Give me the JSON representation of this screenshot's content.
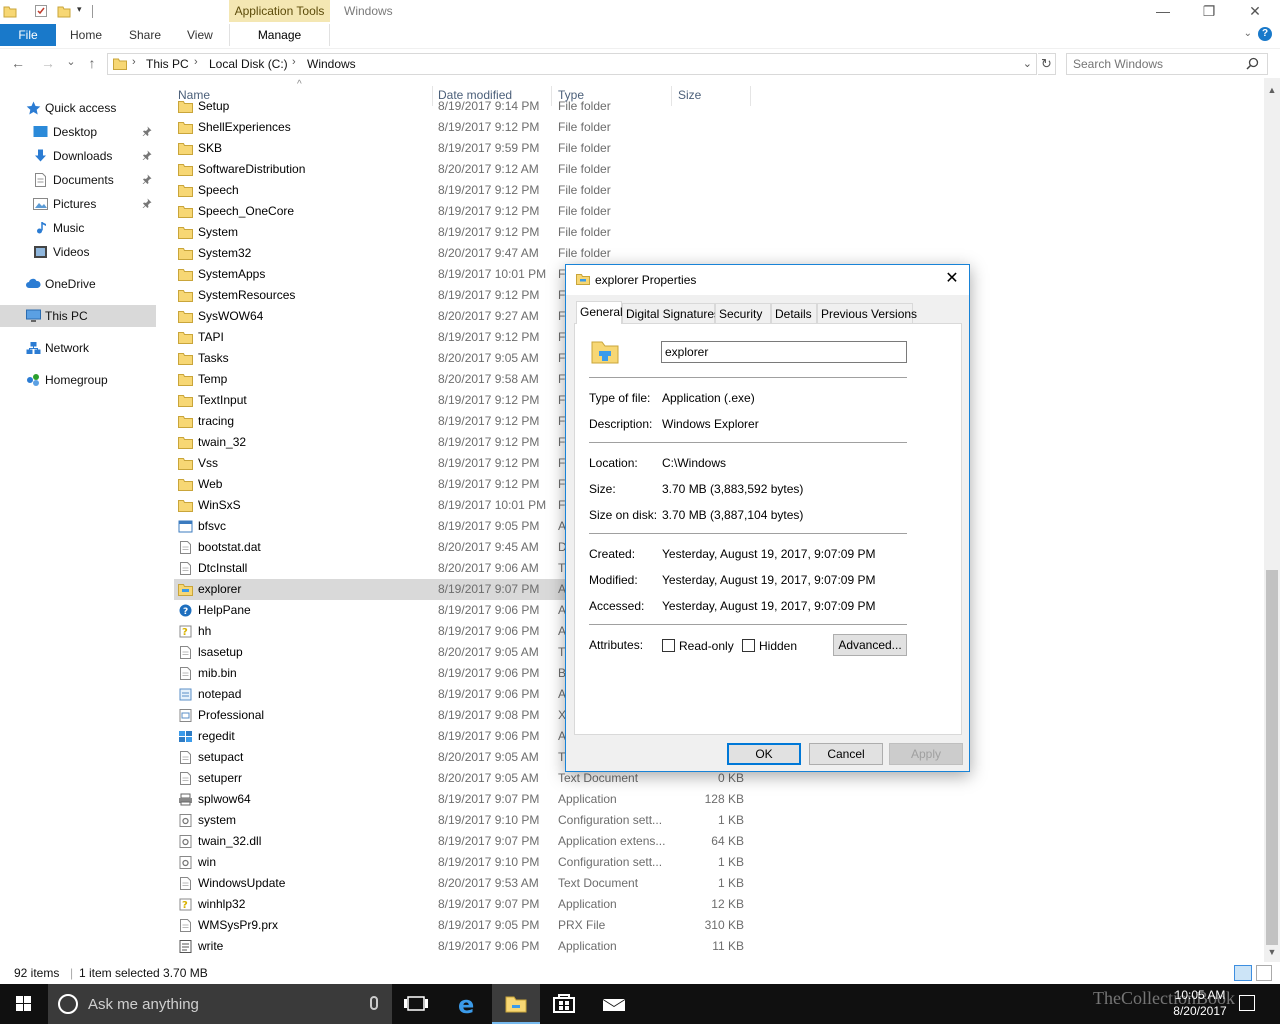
{
  "titlebar": {
    "context_tab_group": "Application Tools",
    "window_title": "Windows",
    "minimize": "—",
    "maximize": "❐",
    "close": "✕"
  },
  "ribbon": {
    "tabs": [
      {
        "label": "File"
      },
      {
        "label": "Home"
      },
      {
        "label": "Share"
      },
      {
        "label": "View"
      },
      {
        "label": "Manage"
      }
    ],
    "expand_icon": "chevron-down-icon",
    "help_icon": "?"
  },
  "address": {
    "back": "←",
    "forward": "→",
    "recent": "⌄",
    "up": "↑",
    "crumbs": [
      "This PC",
      "Local Disk (C:)",
      "Windows"
    ],
    "separator": "›",
    "dropdown": "⌄",
    "refresh": "↻",
    "search_placeholder": "Search Windows"
  },
  "navpane": {
    "items": [
      {
        "label": "Quick access",
        "icon": "star-icon",
        "pinned": false
      },
      {
        "label": "Desktop",
        "icon": "desktop-icon",
        "pinned": true
      },
      {
        "label": "Downloads",
        "icon": "download-icon",
        "pinned": true
      },
      {
        "label": "Documents",
        "icon": "documents-icon",
        "pinned": true
      },
      {
        "label": "Pictures",
        "icon": "pictures-icon",
        "pinned": true
      },
      {
        "label": "Music",
        "icon": "music-icon",
        "pinned": false
      },
      {
        "label": "Videos",
        "icon": "videos-icon",
        "pinned": false
      },
      {
        "label": "OneDrive",
        "icon": "cloud-icon",
        "pinned": false
      },
      {
        "label": "This PC",
        "icon": "computer-icon",
        "pinned": false,
        "selected": true
      },
      {
        "label": "Network",
        "icon": "network-icon",
        "pinned": false
      },
      {
        "label": "Homegroup",
        "icon": "homegroup-icon",
        "pinned": false
      }
    ]
  },
  "columns": {
    "name": "Name",
    "date": "Date modified",
    "type": "Type",
    "size": "Size",
    "sort_indicator": "^"
  },
  "files": [
    {
      "name": "Setup",
      "date": "8/19/2017 9:14 PM",
      "type": "File folder",
      "size": "",
      "icon": "folder"
    },
    {
      "name": "ShellExperiences",
      "date": "8/19/2017 9:12 PM",
      "type": "File folder",
      "size": "",
      "icon": "folder"
    },
    {
      "name": "SKB",
      "date": "8/19/2017 9:59 PM",
      "type": "File folder",
      "size": "",
      "icon": "folder"
    },
    {
      "name": "SoftwareDistribution",
      "date": "8/20/2017 9:12 AM",
      "type": "File folder",
      "size": "",
      "icon": "folder"
    },
    {
      "name": "Speech",
      "date": "8/19/2017 9:12 PM",
      "type": "File folder",
      "size": "",
      "icon": "folder"
    },
    {
      "name": "Speech_OneCore",
      "date": "8/19/2017 9:12 PM",
      "type": "File folder",
      "size": "",
      "icon": "folder"
    },
    {
      "name": "System",
      "date": "8/19/2017 9:12 PM",
      "type": "File folder",
      "size": "",
      "icon": "folder"
    },
    {
      "name": "System32",
      "date": "8/20/2017 9:47 AM",
      "type": "File folder",
      "size": "",
      "icon": "folder"
    },
    {
      "name": "SystemApps",
      "date": "8/19/2017 10:01 PM",
      "type": "F",
      "size": "",
      "icon": "folder"
    },
    {
      "name": "SystemResources",
      "date": "8/19/2017 9:12 PM",
      "type": "F",
      "size": "",
      "icon": "folder"
    },
    {
      "name": "SysWOW64",
      "date": "8/20/2017 9:27 AM",
      "type": "F",
      "size": "",
      "icon": "folder"
    },
    {
      "name": "TAPI",
      "date": "8/19/2017 9:12 PM",
      "type": "F",
      "size": "",
      "icon": "folder"
    },
    {
      "name": "Tasks",
      "date": "8/20/2017 9:05 AM",
      "type": "F",
      "size": "",
      "icon": "folder"
    },
    {
      "name": "Temp",
      "date": "8/20/2017 9:58 AM",
      "type": "F",
      "size": "",
      "icon": "folder"
    },
    {
      "name": "TextInput",
      "date": "8/19/2017 9:12 PM",
      "type": "F",
      "size": "",
      "icon": "folder"
    },
    {
      "name": "tracing",
      "date": "8/19/2017 9:12 PM",
      "type": "F",
      "size": "",
      "icon": "folder"
    },
    {
      "name": "twain_32",
      "date": "8/19/2017 9:12 PM",
      "type": "F",
      "size": "",
      "icon": "folder"
    },
    {
      "name": "Vss",
      "date": "8/19/2017 9:12 PM",
      "type": "F",
      "size": "",
      "icon": "folder"
    },
    {
      "name": "Web",
      "date": "8/19/2017 9:12 PM",
      "type": "F",
      "size": "",
      "icon": "folder"
    },
    {
      "name": "WinSxS",
      "date": "8/19/2017 10:01 PM",
      "type": "F",
      "size": "",
      "icon": "folder"
    },
    {
      "name": "bfsvc",
      "date": "8/19/2017 9:05 PM",
      "type": "A",
      "size": "",
      "icon": "app"
    },
    {
      "name": "bootstat.dat",
      "date": "8/20/2017 9:45 AM",
      "type": "D",
      "size": "",
      "icon": "doc"
    },
    {
      "name": "DtcInstall",
      "date": "8/20/2017 9:06 AM",
      "type": "T",
      "size": "",
      "icon": "doc"
    },
    {
      "name": "explorer",
      "date": "8/19/2017 9:07 PM",
      "type": "A",
      "size": "",
      "icon": "explorer",
      "selected": true
    },
    {
      "name": "HelpPane",
      "date": "8/19/2017 9:06 PM",
      "type": "A",
      "size": "",
      "icon": "help"
    },
    {
      "name": "hh",
      "date": "8/19/2017 9:06 PM",
      "type": "A",
      "size": "",
      "icon": "hh"
    },
    {
      "name": "lsasetup",
      "date": "8/20/2017 9:05 AM",
      "type": "T",
      "size": "",
      "icon": "doc"
    },
    {
      "name": "mib.bin",
      "date": "8/19/2017 9:06 PM",
      "type": "B",
      "size": "",
      "icon": "doc"
    },
    {
      "name": "notepad",
      "date": "8/19/2017 9:06 PM",
      "type": "A",
      "size": "",
      "icon": "notepad"
    },
    {
      "name": "Professional",
      "date": "8/19/2017 9:08 PM",
      "type": "X",
      "size": "",
      "icon": "xml"
    },
    {
      "name": "regedit",
      "date": "8/19/2017 9:06 PM",
      "type": "A",
      "size": "",
      "icon": "regedit"
    },
    {
      "name": "setupact",
      "date": "8/20/2017 9:05 AM",
      "type": "T",
      "size": "",
      "icon": "doc"
    },
    {
      "name": "setuperr",
      "date": "8/20/2017 9:05 AM",
      "type": "Text Document",
      "size": "0 KB",
      "icon": "doc"
    },
    {
      "name": "splwow64",
      "date": "8/19/2017 9:07 PM",
      "type": "Application",
      "size": "128 KB",
      "icon": "printer"
    },
    {
      "name": "system",
      "date": "8/19/2017 9:10 PM",
      "type": "Configuration sett...",
      "size": "1 KB",
      "icon": "config"
    },
    {
      "name": "twain_32.dll",
      "date": "8/19/2017 9:07 PM",
      "type": "Application extens...",
      "size": "64 KB",
      "icon": "config"
    },
    {
      "name": "win",
      "date": "8/19/2017 9:10 PM",
      "type": "Configuration sett...",
      "size": "1 KB",
      "icon": "config"
    },
    {
      "name": "WindowsUpdate",
      "date": "8/20/2017 9:53 AM",
      "type": "Text Document",
      "size": "1 KB",
      "icon": "doc"
    },
    {
      "name": "winhlp32",
      "date": "8/19/2017 9:07 PM",
      "type": "Application",
      "size": "12 KB",
      "icon": "hh"
    },
    {
      "name": "WMSysPr9.prx",
      "date": "8/19/2017 9:05 PM",
      "type": "PRX File",
      "size": "310 KB",
      "icon": "doc"
    },
    {
      "name": "write",
      "date": "8/19/2017 9:06 PM",
      "type": "Application",
      "size": "11 KB",
      "icon": "write"
    }
  ],
  "status": {
    "count": "92 items",
    "selection": "1 item selected  3.70 MB"
  },
  "taskbar": {
    "search_text": "Ask me anything",
    "time": "10:05 AM",
    "date": "8/20/2017",
    "watermark": "TheCollectionBook"
  },
  "dialog": {
    "title": "explorer Properties",
    "close": "✕",
    "tabs": [
      "General",
      "Digital Signatures",
      "Security",
      "Details",
      "Previous Versions"
    ],
    "name_value": "explorer",
    "type_label": "Type of file:",
    "type_value": "Application (.exe)",
    "desc_label": "Description:",
    "desc_value": "Windows Explorer",
    "location_label": "Location:",
    "location_value": "C:\\Windows",
    "size_label": "Size:",
    "size_value": "3.70 MB (3,883,592 bytes)",
    "disk_label": "Size on disk:",
    "disk_value": "3.70 MB (3,887,104 bytes)",
    "created_label": "Created:",
    "created_value": "Yesterday, August 19, 2017, 9:07:09 PM",
    "modified_label": "Modified:",
    "modified_value": "Yesterday, August 19, 2017, 9:07:09 PM",
    "accessed_label": "Accessed:",
    "accessed_value": "Yesterday, August 19, 2017, 9:07:09 PM",
    "attributes_label": "Attributes:",
    "readonly_label": "Read-only",
    "hidden_label": "Hidden",
    "advanced_label": "Advanced...",
    "ok_label": "OK",
    "cancel_label": "Cancel",
    "apply_label": "Apply"
  }
}
